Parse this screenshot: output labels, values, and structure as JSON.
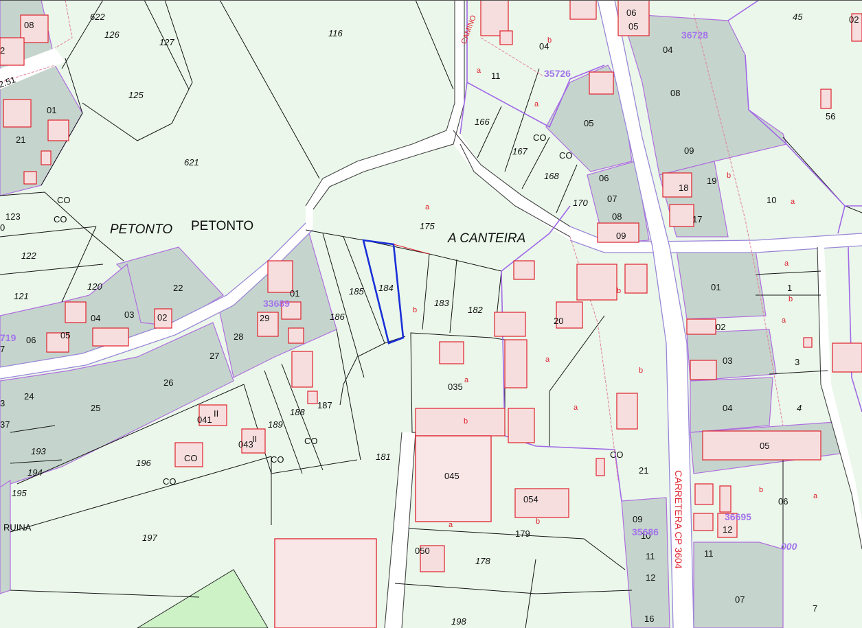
{
  "place_names": {
    "petonto_italic": "PETONTO",
    "petonto_plain": "PETONTO",
    "a_canteira": "A CANTEIRA",
    "road_name": "CARRETERA CP 3604",
    "camino": "CAMINO",
    "ruina": "RUINA"
  },
  "plot_numbers": {
    "p622": "622",
    "p126": "126",
    "p127": "127",
    "p116": "116",
    "p125": "125",
    "p621": "621",
    "p123": "123",
    "p122": "122",
    "p121": "121",
    "p120": "120",
    "p175": "175",
    "p185": "185",
    "p184": "184",
    "p183": "183",
    "p182": "182",
    "p186": "186",
    "p187": "187",
    "p188": "188",
    "p189": "189",
    "p181": "181",
    "p166": "166",
    "p167": "167",
    "p168": "168",
    "p170": "170",
    "p196": "196",
    "p197": "197",
    "p193": "193",
    "p194": "194",
    "p195": "195",
    "p178": "178",
    "p179": "179",
    "p198": "198",
    "p45": "45",
    "p56": "56"
  },
  "block_numbers": {
    "b08a": "08",
    "b01a": "01",
    "b21a": "21",
    "b22": "22",
    "b04a": "04",
    "b03a": "03",
    "b02a": "02",
    "b05a": "05",
    "b06a": "06",
    "b01b": "01",
    "b29": "29",
    "b28": "28",
    "b27": "27",
    "b26": "26",
    "b25": "25",
    "b24": "24",
    "b041": "041",
    "b043": "043",
    "b035": "035",
    "b045": "045",
    "b054": "054",
    "b050": "050",
    "b20": "20",
    "b21b": "21",
    "b06b": "06",
    "b05b": "05",
    "b04b": "04",
    "b11a": "11",
    "b05c": "05",
    "b06c": "06",
    "b07a": "07",
    "b08b": "08",
    "b09a": "09",
    "b04c": "04",
    "b08c": "08",
    "b09b": "09",
    "b18": "18",
    "b19": "19",
    "b17": "17",
    "b10a": "10",
    "b01c": "01",
    "b02b": "02",
    "b03b": "03",
    "b04d": "04",
    "b05d": "05",
    "b06d": "06",
    "b12": "12",
    "b11b": "11",
    "b07b": "07",
    "b09c": "09",
    "b10b": "10",
    "b11c": "11",
    "b12b": "12",
    "b16": "16",
    "b1": "1",
    "b3": "3",
    "b4": "4",
    "b7": "7",
    "b0": "0",
    "b3l": "3",
    "b7l": "7",
    "b251": "2.51",
    "b2l": "2",
    "b37": "37"
  },
  "sheet_numbers": {
    "s33689": "33689",
    "s35726": "35726",
    "s36728": "36728",
    "s36695": "36695",
    "s35686": "35686",
    "s719": "719",
    "s000": "000",
    "s02r": "02"
  },
  "subparcel_letters": {
    "a": "a",
    "b": "b",
    "co": "CO",
    "ii": "II"
  },
  "colors": {
    "background": "#eaf7ea",
    "grey_block": "#c5d5cd",
    "parcel_line": "#151515",
    "violet_boundary": "#a168e8",
    "building": "#e0202c",
    "selected_parcel": "#1a2fd8",
    "road": "#ffffff"
  }
}
